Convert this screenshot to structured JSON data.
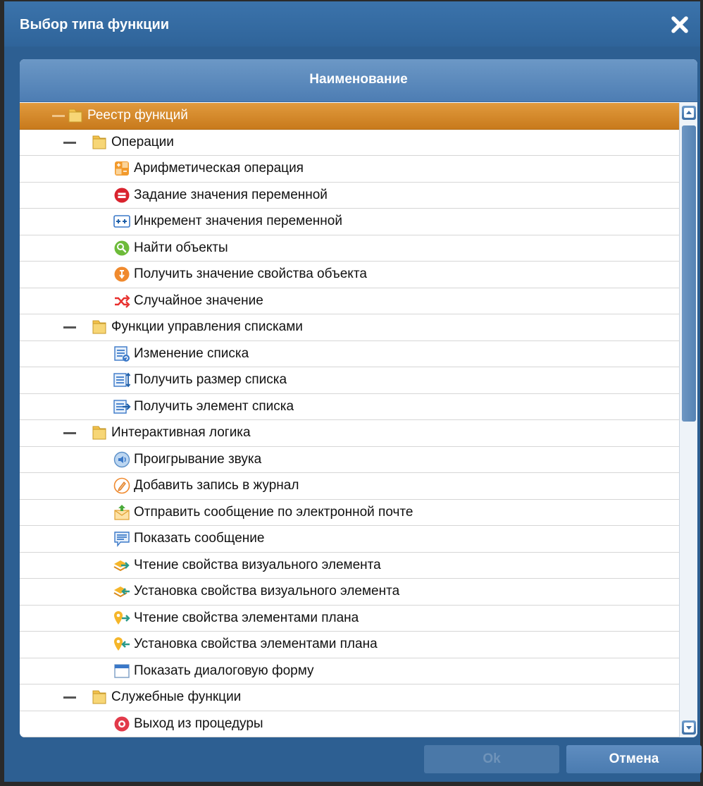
{
  "dialog": {
    "title": "Выбор типа функции"
  },
  "table": {
    "column_header": "Наименование"
  },
  "tree": [
    {
      "label": "Реестр функций",
      "level": 0,
      "type": "folder",
      "selected": true
    },
    {
      "label": "Операции",
      "level": 1,
      "type": "folder"
    },
    {
      "label": "Арифметическая операция",
      "level": 2,
      "icon": "calculator-icon"
    },
    {
      "label": "Задание значения переменной",
      "level": 2,
      "icon": "assign-value-icon"
    },
    {
      "label": "Инкремент значения переменной",
      "level": 2,
      "icon": "increment-icon"
    },
    {
      "label": "Найти объекты",
      "level": 2,
      "icon": "find-objects-icon"
    },
    {
      "label": "Получить значение свойства объекта",
      "level": 2,
      "icon": "get-property-icon"
    },
    {
      "label": "Случайное значение",
      "level": 2,
      "icon": "shuffle-icon"
    },
    {
      "label": "Функции управления списками",
      "level": 1,
      "type": "folder"
    },
    {
      "label": "Изменение списка",
      "level": 2,
      "icon": "list-edit-icon"
    },
    {
      "label": "Получить размер списка",
      "level": 2,
      "icon": "list-size-icon"
    },
    {
      "label": "Получить элемент списка",
      "level": 2,
      "icon": "list-item-icon"
    },
    {
      "label": "Интерактивная логика",
      "level": 1,
      "type": "folder"
    },
    {
      "label": "Проигрывание звука",
      "level": 2,
      "icon": "sound-icon"
    },
    {
      "label": "Добавить запись в журнал",
      "level": 2,
      "icon": "journal-icon"
    },
    {
      "label": "Отправить сообщение по электронной почте",
      "level": 2,
      "icon": "email-send-icon"
    },
    {
      "label": "Показать сообщение",
      "level": 2,
      "icon": "message-icon"
    },
    {
      "label": "Чтение свойства визуального элемента",
      "level": 2,
      "icon": "visual-read-icon"
    },
    {
      "label": "Установка свойства визуального элемента",
      "level": 2,
      "icon": "visual-write-icon"
    },
    {
      "label": "Чтение свойства элементами плана",
      "level": 2,
      "icon": "plan-read-icon"
    },
    {
      "label": "Установка свойства элементами плана",
      "level": 2,
      "icon": "plan-write-icon"
    },
    {
      "label": "Показать диалоговую форму",
      "level": 2,
      "icon": "dialog-form-icon"
    },
    {
      "label": "Служебные функции",
      "level": 1,
      "type": "folder"
    },
    {
      "label": "Выход из процедуры",
      "level": 2,
      "icon": "exit-procedure-icon"
    }
  ],
  "buttons": {
    "ok": "Ok",
    "cancel": "Отмена"
  },
  "colors": {
    "titlebar": "#3b73ab",
    "selected_row": "#d98a2a",
    "header": "#5c8bbd"
  }
}
